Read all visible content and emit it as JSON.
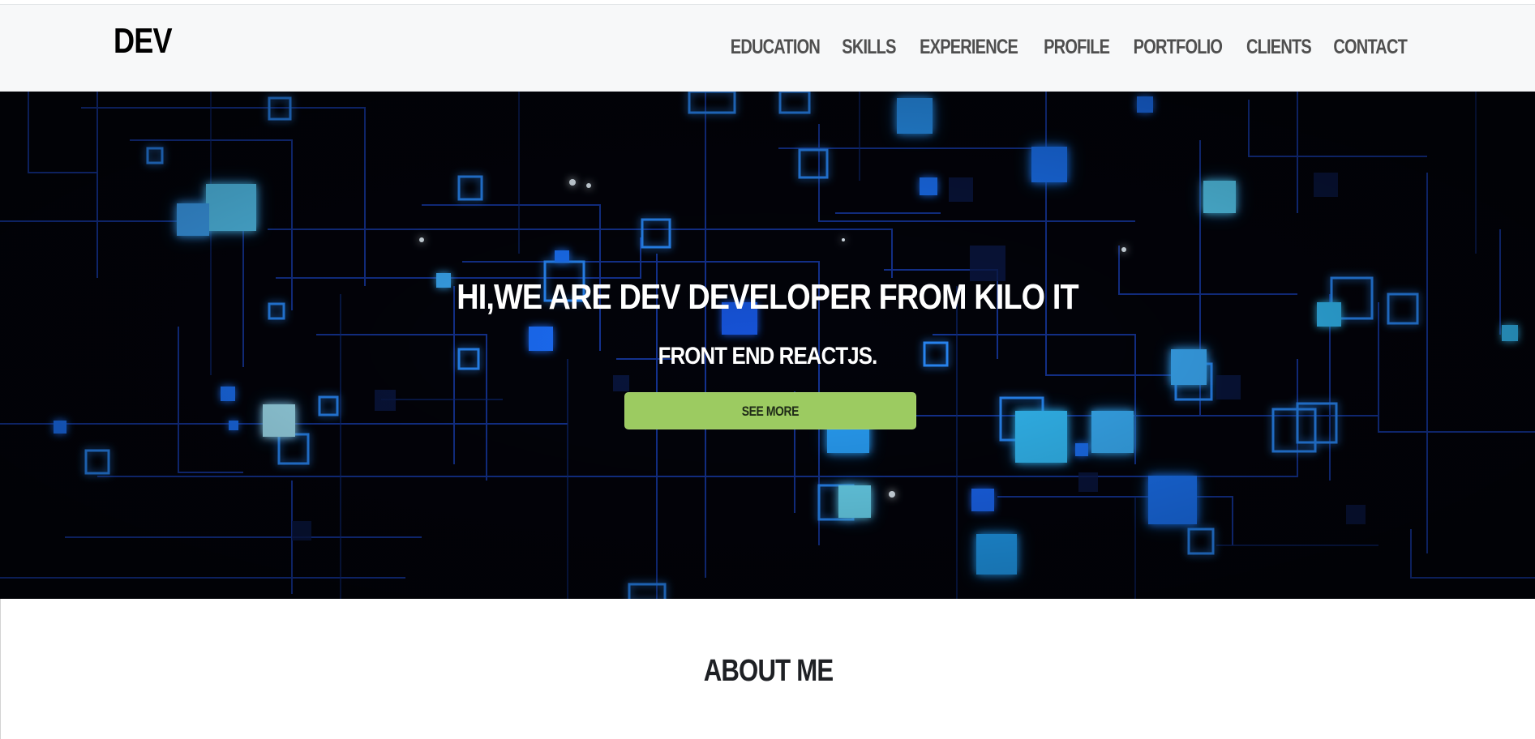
{
  "header": {
    "brand": "DEV",
    "nav": [
      {
        "label": "EDUCATION"
      },
      {
        "label": "SKILLS"
      },
      {
        "label": "EXPERIENCE"
      },
      {
        "label": "PROFILE"
      },
      {
        "label": "PORTFOLIO"
      },
      {
        "label": "CLIENTS"
      },
      {
        "label": "CONTACT"
      }
    ]
  },
  "hero": {
    "headline": "HI,WE ARE DEV DEVELOPER FROM KILO IT",
    "subheadline": "FRONT END REACTJS.",
    "cta_label": "SEE MORE",
    "background_theme": "blue-circuit-grid"
  },
  "about": {
    "title": "ABOUT ME"
  },
  "colors": {
    "header_bg": "#f7f8f9",
    "hero_bg": "#02030a",
    "accent_green": "#9ccb61",
    "glow_blue": "#2a8cff",
    "line_blue": "#173a9e"
  }
}
